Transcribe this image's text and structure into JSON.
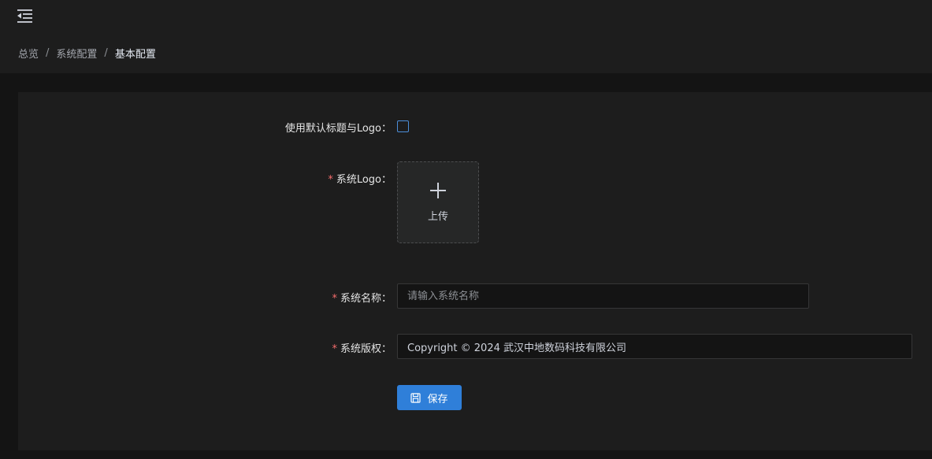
{
  "header": {
    "menu_icon": "menu-fold-icon"
  },
  "breadcrumb": {
    "items": [
      "总览",
      "系统配置",
      "基本配置"
    ],
    "separator": "/"
  },
  "form": {
    "use_default": {
      "label": "使用默认标题与Logo：",
      "checked": false
    },
    "logo": {
      "label": "系统Logo：",
      "required": true,
      "upload_text": "上传",
      "icon": "plus-icon"
    },
    "name": {
      "label": "系统名称：",
      "required": true,
      "value": "",
      "placeholder": "请输入系统名称"
    },
    "copyright": {
      "label": "系统版权：",
      "required": true,
      "value": "Copyright © 2024 武汉中地数码科技有限公司",
      "placeholder": ""
    },
    "save": {
      "label": "保存",
      "icon": "save-icon"
    }
  },
  "colors": {
    "primary": "#2f7fd9",
    "required": "#f56c6c",
    "background": "#141414",
    "panel": "#1d1d1d"
  }
}
